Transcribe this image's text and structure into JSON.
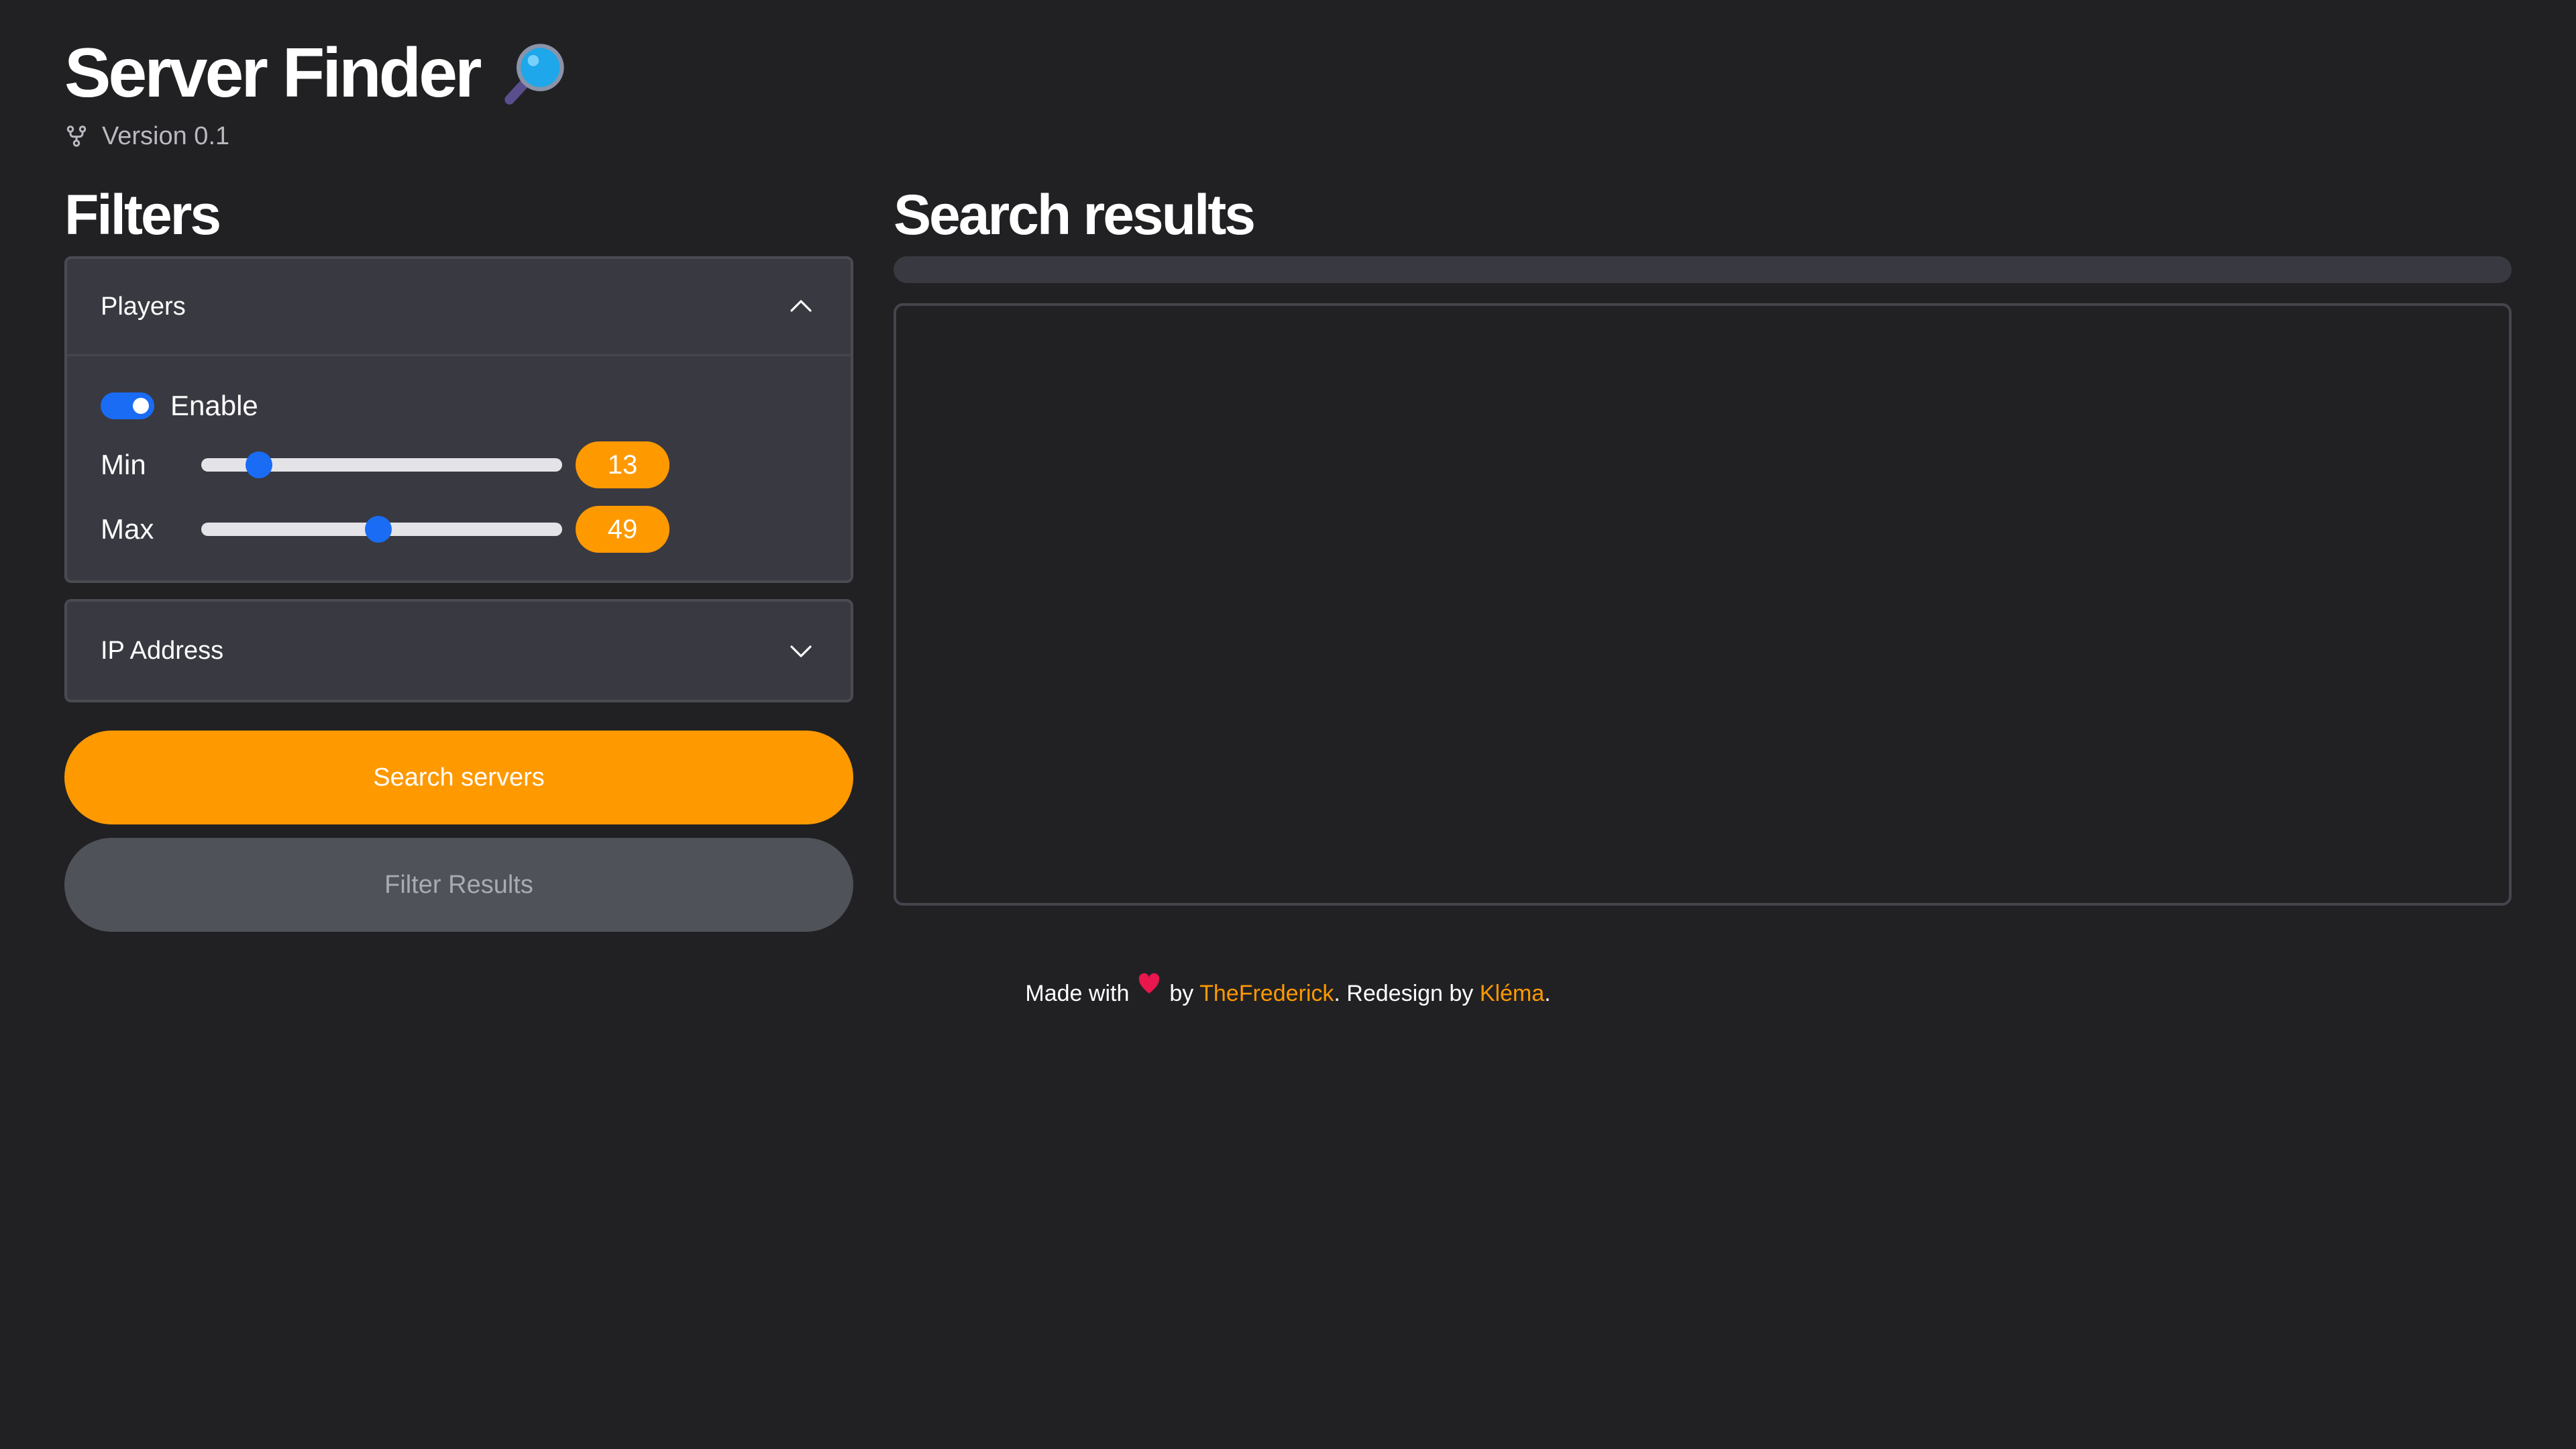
{
  "header": {
    "title": "Server Finder",
    "title_icon": "magnifying-glass-icon",
    "version_icon": "git-fork-icon",
    "version": "Version 0.1"
  },
  "filters": {
    "title": "Filters",
    "players": {
      "label": "Players",
      "expanded": true,
      "enable_label": "Enable",
      "enabled": true,
      "min_label": "Min",
      "min_value": "13",
      "min_fraction": 0.16,
      "max_label": "Max",
      "max_value": "49",
      "max_fraction": 0.49
    },
    "ip_address": {
      "label": "IP Address",
      "expanded": false
    },
    "search_button": "Search servers",
    "filter_button": "Filter Results"
  },
  "results": {
    "title": "Search results",
    "progress": 0
  },
  "footer": {
    "made_with": "Made with",
    "by": "by",
    "author": "TheFrederick",
    "redesign": ". Redesign by",
    "designer": "Kléma",
    "end": "."
  },
  "colors": {
    "background": "#212124",
    "panel": "#393941",
    "accent": "#ff9900",
    "toggle": "#1a6cf5",
    "heart": "#e8174d",
    "secondary_button": "#50525a"
  }
}
